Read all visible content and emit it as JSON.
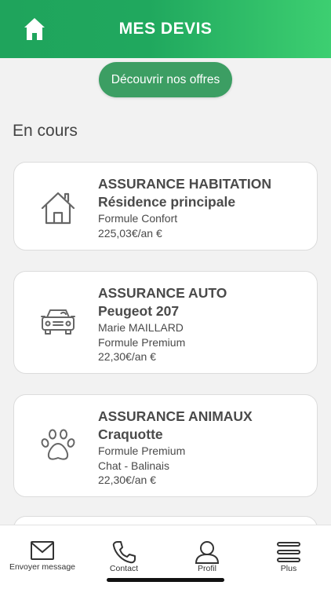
{
  "header": {
    "title": "MES DEVIS",
    "home_icon": "home-icon"
  },
  "offers_button": "Découvrir nos offres",
  "section_title": "En cours",
  "cards": [
    {
      "icon": "house-icon",
      "title": "ASSURANCE HABITATION",
      "subtitle": "Résidence principale",
      "lines": [
        "Formule Confort",
        "225,03€/an €"
      ]
    },
    {
      "icon": "car-icon",
      "title": "ASSURANCE AUTO",
      "subtitle": "Peugeot 207",
      "lines": [
        "Marie MAILLARD",
        "Formule Premium",
        "22,30€/an €"
      ]
    },
    {
      "icon": "paw-icon",
      "title": "ASSURANCE ANIMAUX",
      "subtitle": "Craquotte",
      "lines": [
        "Formule Premium",
        "Chat - Balinais",
        "22,30€/an €"
      ]
    }
  ],
  "tabbar": {
    "items": [
      {
        "label": "Envoyer message",
        "icon": "envelope-icon"
      },
      {
        "label": "Contact",
        "icon": "phone-icon"
      },
      {
        "label": "Profil",
        "icon": "user-icon"
      },
      {
        "label": "Plus",
        "icon": "menu-icon"
      }
    ]
  },
  "colors": {
    "header_start": "#1fa45c",
    "header_end": "#3dcf71",
    "button": "#3c9e63",
    "background": "#f2f2f2"
  }
}
